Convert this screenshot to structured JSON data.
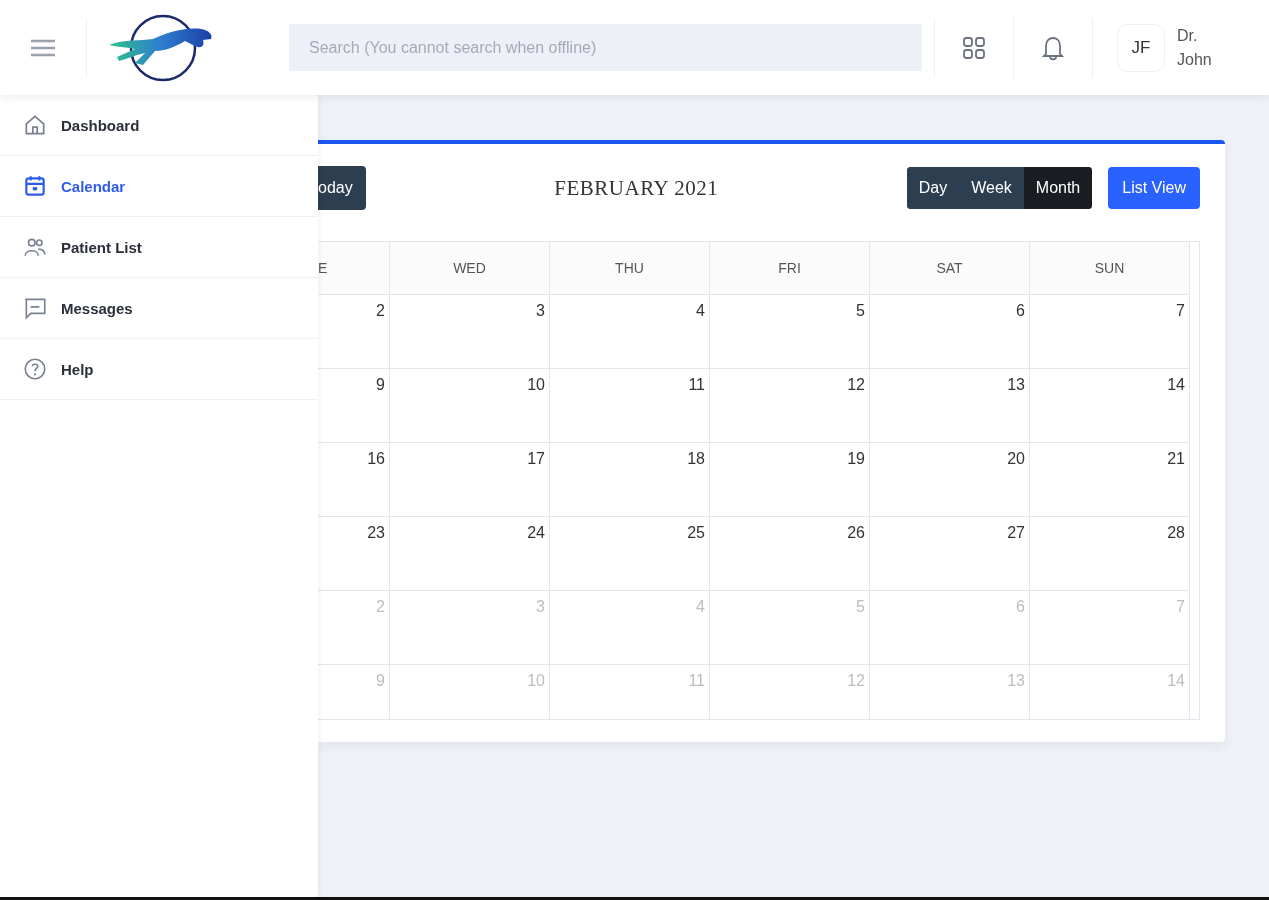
{
  "header": {
    "search": {
      "placeholder": "Search (You cannot search when offline)"
    },
    "user": {
      "initials": "JF",
      "name": "Dr. John"
    }
  },
  "sidebar": {
    "items": [
      {
        "label": "Dashboard",
        "selected": false
      },
      {
        "label": "Calendar",
        "selected": true
      },
      {
        "label": "Patient List",
        "selected": false
      },
      {
        "label": "Messages",
        "selected": false
      },
      {
        "label": "Help",
        "selected": false
      }
    ]
  },
  "calendar": {
    "today_button": "oday",
    "title": "FEBRUARY 2021",
    "views": [
      {
        "label": "Day",
        "selected": false
      },
      {
        "label": "Week",
        "selected": false
      },
      {
        "label": "Month",
        "selected": true
      }
    ],
    "list_view_button": "List View",
    "columns": [
      "E",
      "WED",
      "THU",
      "FRI",
      "SAT",
      "SUN"
    ],
    "rows": [
      [
        {
          "day": "2",
          "other_month": false
        },
        {
          "day": "3",
          "other_month": false
        },
        {
          "day": "4",
          "other_month": false
        },
        {
          "day": "5",
          "other_month": false
        },
        {
          "day": "6",
          "other_month": false
        },
        {
          "day": "7",
          "other_month": false
        }
      ],
      [
        {
          "day": "9",
          "other_month": false
        },
        {
          "day": "10",
          "other_month": false
        },
        {
          "day": "11",
          "other_month": false
        },
        {
          "day": "12",
          "other_month": false
        },
        {
          "day": "13",
          "other_month": false
        },
        {
          "day": "14",
          "other_month": false
        }
      ],
      [
        {
          "day": "16",
          "other_month": false
        },
        {
          "day": "17",
          "other_month": false
        },
        {
          "day": "18",
          "other_month": false
        },
        {
          "day": "19",
          "other_month": false
        },
        {
          "day": "20",
          "other_month": false
        },
        {
          "day": "21",
          "other_month": false
        }
      ],
      [
        {
          "day": "23",
          "other_month": false
        },
        {
          "day": "24",
          "other_month": false
        },
        {
          "day": "25",
          "other_month": false
        },
        {
          "day": "26",
          "other_month": false
        },
        {
          "day": "27",
          "other_month": false
        },
        {
          "day": "28",
          "other_month": false
        }
      ],
      [
        {
          "day": "2",
          "other_month": true
        },
        {
          "day": "3",
          "other_month": true
        },
        {
          "day": "4",
          "other_month": true
        },
        {
          "day": "5",
          "other_month": true
        },
        {
          "day": "6",
          "other_month": true
        },
        {
          "day": "7",
          "other_month": true
        }
      ],
      [
        {
          "day": "9",
          "other_month": true
        },
        {
          "day": "10",
          "other_month": true
        },
        {
          "day": "11",
          "other_month": true
        },
        {
          "day": "12",
          "other_month": true
        },
        {
          "day": "13",
          "other_month": true
        },
        {
          "day": "14",
          "other_month": true
        }
      ]
    ]
  }
}
